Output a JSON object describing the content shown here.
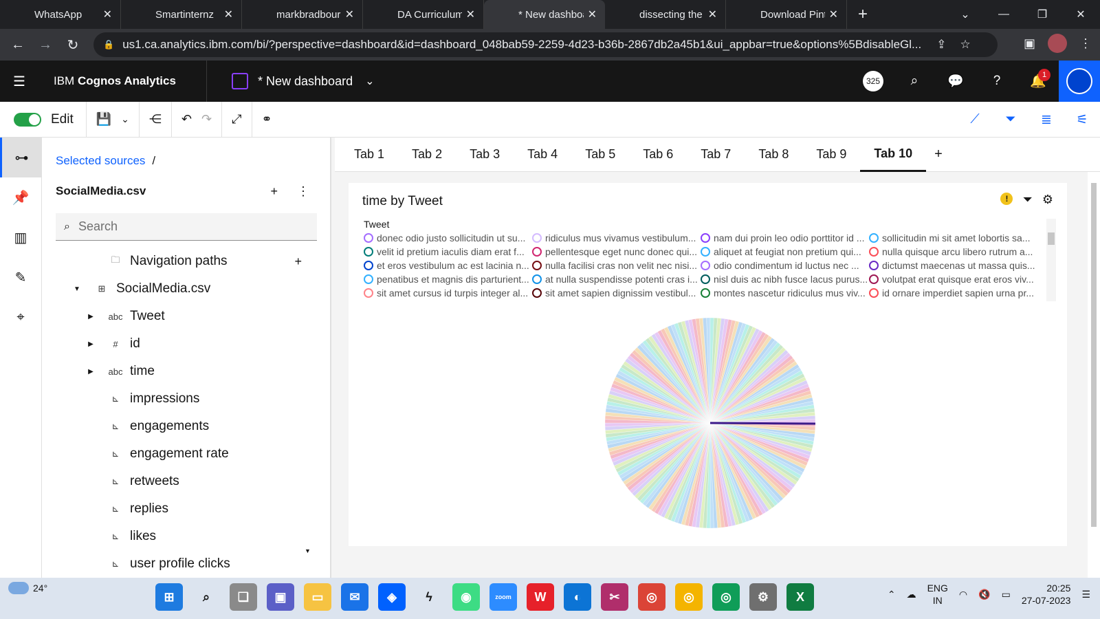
{
  "browser": {
    "tabs": [
      {
        "title": "WhatsApp",
        "icon": "whatsapp-icon",
        "color": "#25d366"
      },
      {
        "title": "Smartinternz",
        "icon": "page-icon",
        "color": "#1a73e8"
      },
      {
        "title": "markbradbourn",
        "icon": "github-icon",
        "color": "#ffffff"
      },
      {
        "title": "DA Curriculum",
        "icon": "page-icon",
        "color": "#1a73e8"
      },
      {
        "title": "* New dashboa",
        "icon": "cognos-icon",
        "color": "#8a3ffc"
      },
      {
        "title": "dissecting the",
        "icon": "google-icon",
        "color": "#4285f4"
      },
      {
        "title": "Download Pint",
        "icon": "google-icon",
        "color": "#000000"
      }
    ],
    "url": "us1.ca.analytics.ibm.com/bi/?perspective=dashboard&id=dashboard_048bab59-2259-4d23-b36b-2867db2a45b1&ui_appbar=true&options%5BdisableGl..."
  },
  "app": {
    "brand_prefix": "IBM",
    "brand_name": "Cognos Analytics",
    "dashboard_title": "* New dashboard",
    "count_badge": "325",
    "notif_count": "1",
    "edit_label": "Edit"
  },
  "source_panel": {
    "breadcrumb": "Selected sources",
    "breadcrumb_sep": "/",
    "source_name": "SocialMedia.csv",
    "search_placeholder": "Search",
    "tree": [
      {
        "label": "Navigation paths",
        "icon": "folder-icon",
        "level": 1,
        "arrow": "",
        "plus": true
      },
      {
        "label": "SocialMedia.csv",
        "icon": "table-icon",
        "level": 0,
        "arrow": "down"
      },
      {
        "label": "Tweet",
        "icon": "abc-icon",
        "level": 1,
        "arrow": "right"
      },
      {
        "label": "id",
        "icon": "hash-icon",
        "level": 1,
        "arrow": "right"
      },
      {
        "label": "time",
        "icon": "abc-icon",
        "level": 1,
        "arrow": "right"
      },
      {
        "label": "impressions",
        "icon": "measure-icon",
        "level": 1,
        "arrow": ""
      },
      {
        "label": "engagements",
        "icon": "measure-icon",
        "level": 1,
        "arrow": ""
      },
      {
        "label": "engagement rate",
        "icon": "measure-icon",
        "level": 1,
        "arrow": ""
      },
      {
        "label": "retweets",
        "icon": "measure-icon",
        "level": 1,
        "arrow": ""
      },
      {
        "label": "replies",
        "icon": "measure-icon",
        "level": 1,
        "arrow": ""
      },
      {
        "label": "likes",
        "icon": "measure-icon",
        "level": 1,
        "arrow": ""
      },
      {
        "label": "user profile clicks",
        "icon": "measure-icon",
        "level": 1,
        "arrow": ""
      }
    ]
  },
  "dashboard": {
    "tabs": [
      "Tab 1",
      "Tab 2",
      "Tab 3",
      "Tab 4",
      "Tab 5",
      "Tab 6",
      "Tab 7",
      "Tab 8",
      "Tab 9",
      "Tab 10"
    ],
    "active_tab": 9,
    "add_tab": "+",
    "widget": {
      "title": "time by Tweet",
      "legend_title": "Tweet",
      "legend": [
        {
          "label": "donec odio justo sollicitudin ut su...",
          "color": "#a56eff"
        },
        {
          "label": "ridiculus mus vivamus vestibulum...",
          "color": "#d4bbff"
        },
        {
          "label": "nam dui proin leo odio porttitor id ...",
          "color": "#8a3ffc"
        },
        {
          "label": "sollicitudin mi sit amet lobortis sa...",
          "color": "#33b1ff"
        },
        {
          "label": "velit id pretium iaculis diam erat f...",
          "color": "#007d79"
        },
        {
          "label": "pellentesque eget nunc donec qui...",
          "color": "#d02670"
        },
        {
          "label": "aliquet at feugiat non pretium qui...",
          "color": "#33b1ff"
        },
        {
          "label": "nulla quisque arcu libero rutrum a...",
          "color": "#fa4d56"
        },
        {
          "label": "et eros vestibulum ac est lacinia n...",
          "color": "#0043ce"
        },
        {
          "label": "nulla facilisi cras non velit nec nisi...",
          "color": "#750e13"
        },
        {
          "label": "odio condimentum id luctus nec ...",
          "color": "#a56eff"
        },
        {
          "label": "dictumst maecenas ut massa quis...",
          "color": "#6929c4"
        },
        {
          "label": "penatibus et magnis dis parturient...",
          "color": "#33b1ff"
        },
        {
          "label": "at nulla suspendisse potenti cras i...",
          "color": "#1192e8"
        },
        {
          "label": "nisl duis ac nibh fusce lacus purus...",
          "color": "#005d5d"
        },
        {
          "label": "volutpat erat quisque erat eros viv...",
          "color": "#9f1853"
        },
        {
          "label": "sit amet cursus id turpis integer al...",
          "color": "#ff8389"
        },
        {
          "label": "sit amet sapien dignissim vestibul...",
          "color": "#570408"
        },
        {
          "label": "montes nascetur ridiculus mus viv...",
          "color": "#198038"
        },
        {
          "label": "id ornare imperdiet sapien urna pr...",
          "color": "#fa4d56"
        }
      ],
      "highlight_color": "#3c1a8a"
    }
  },
  "taskbar": {
    "temperature": "24°",
    "language": "ENG",
    "region": "IN",
    "time": "20:25",
    "date": "27-07-2023"
  }
}
